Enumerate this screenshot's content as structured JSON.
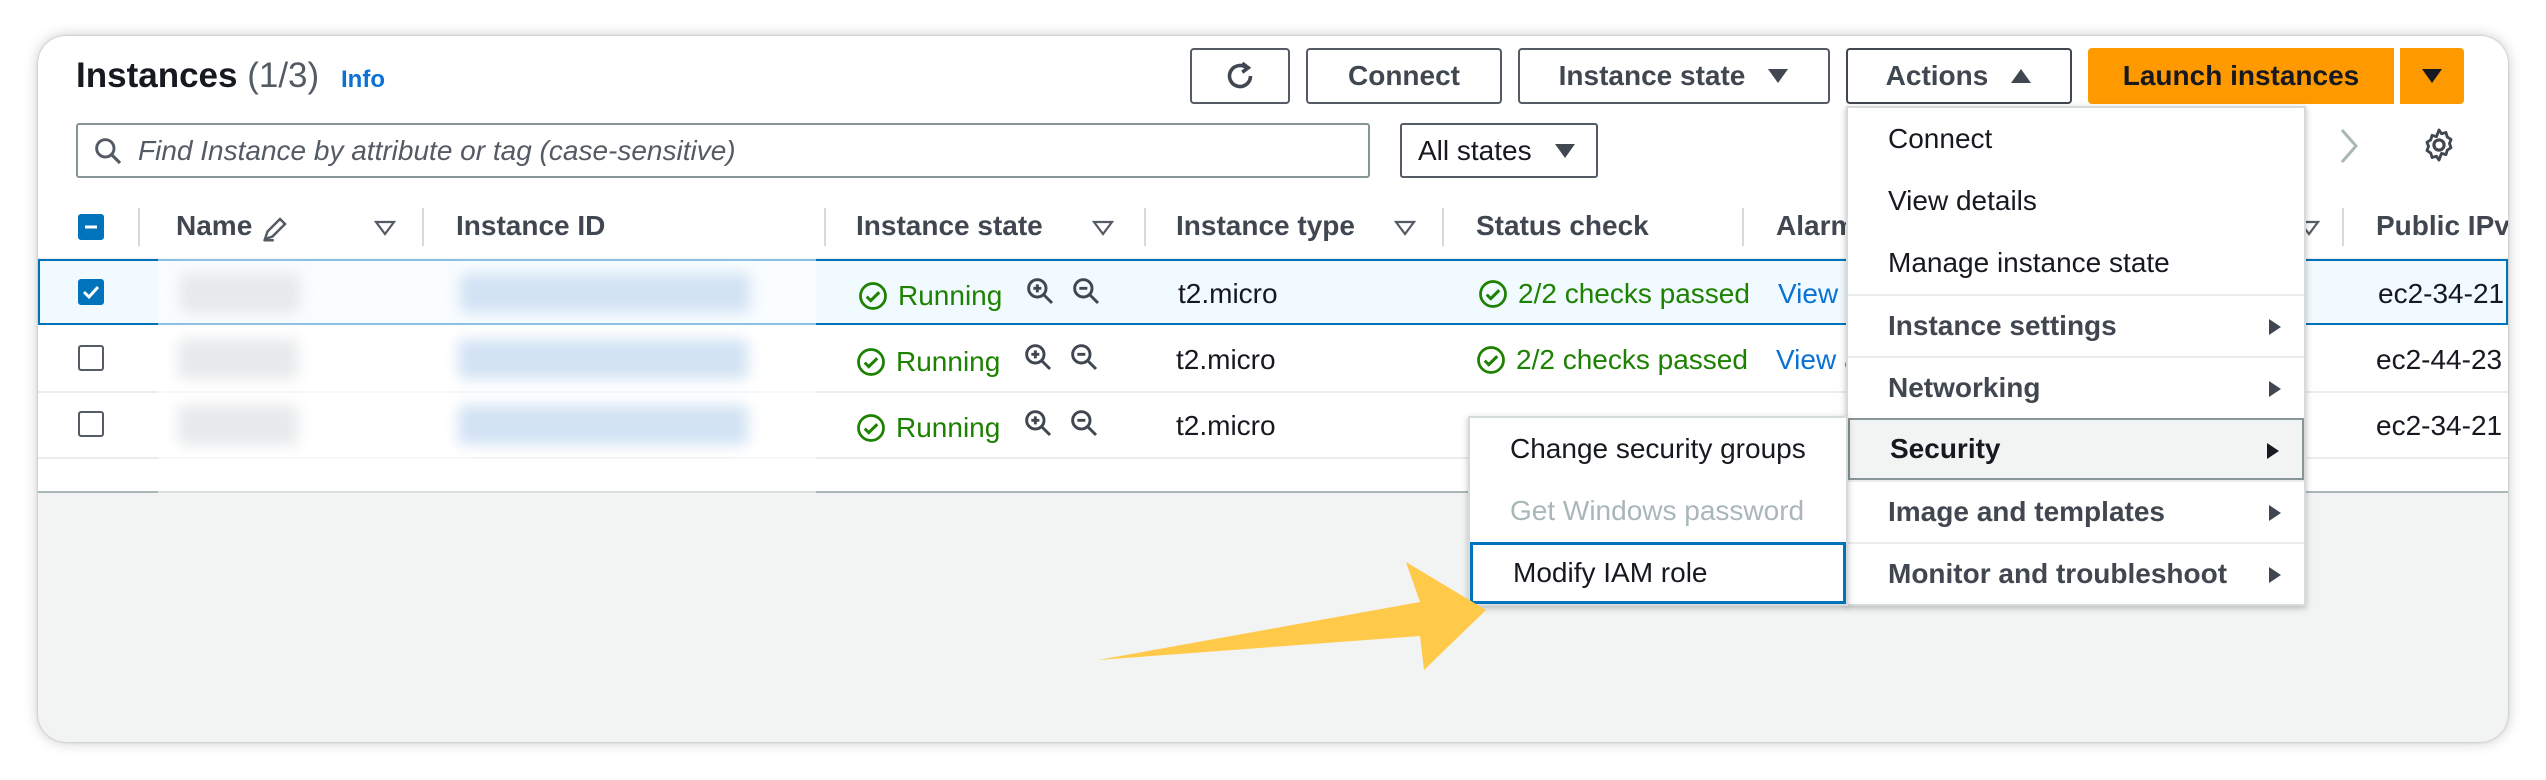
{
  "header": {
    "title": "Instances",
    "count": "(1/3)",
    "info": "Info"
  },
  "toolbar": {
    "connect": "Connect",
    "instance_state": "Instance state",
    "actions": "Actions",
    "launch": "Launch instances"
  },
  "search": {
    "placeholder": "Find Instance by attribute or tag (case-sensitive)",
    "states": "All states"
  },
  "table": {
    "columns": {
      "name": "Name",
      "instance_id": "Instance ID",
      "instance_state": "Instance state",
      "instance_type": "Instance type",
      "status_check": "Status check",
      "alarm": "Alarm",
      "public_ipv": "Public IPv"
    },
    "rows": [
      {
        "selected": true,
        "state": "Running",
        "type": "t2.micro",
        "status": "2/2 checks passed",
        "alarm": "View a",
        "public": "ec2-34-21"
      },
      {
        "selected": false,
        "state": "Running",
        "type": "t2.micro",
        "status": "2/2 checks passed",
        "alarm": "View a",
        "public": "ec2-44-23"
      },
      {
        "selected": false,
        "state": "Running",
        "type": "t2.micro",
        "status": "",
        "alarm": "",
        "public": "ec2-34-21"
      }
    ]
  },
  "actions_menu": {
    "items": [
      "Connect",
      "View details",
      "Manage instance state"
    ],
    "groups": [
      "Instance settings",
      "Networking",
      "Security",
      "Image and templates",
      "Monitor and troubleshoot"
    ],
    "active_group": "Security"
  },
  "security_submenu": {
    "items": [
      "Change security groups",
      "Get Windows password",
      "Modify IAM role"
    ],
    "disabled": "Get Windows password",
    "highlighted": "Modify IAM role"
  },
  "colors": {
    "accent": "#0073bb",
    "link": "#0972d3",
    "launch": "#ff9900",
    "success": "#1d8102",
    "callout": "#ffc94a"
  }
}
